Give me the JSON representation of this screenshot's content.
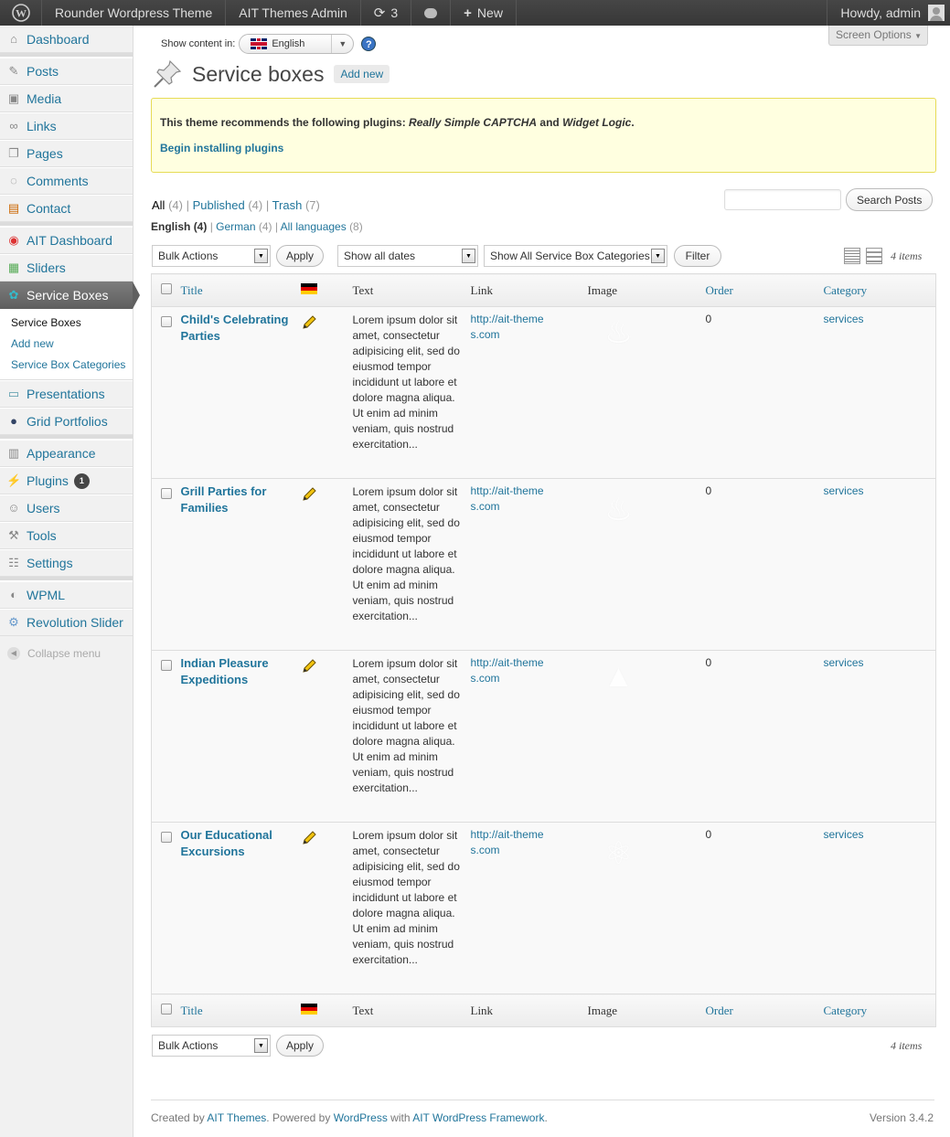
{
  "adminbar": {
    "site_name": "Rounder Wordpress Theme",
    "ait_admin": "AIT Themes Admin",
    "updates_count": "3",
    "new_label": "New",
    "howdy": "Howdy, admin"
  },
  "sidebar": {
    "dashboard": "Dashboard",
    "posts": "Posts",
    "media": "Media",
    "links": "Links",
    "pages": "Pages",
    "comments": "Comments",
    "contact": "Contact",
    "ait_dashboard": "AIT Dashboard",
    "sliders": "Sliders",
    "service_boxes": "Service Boxes",
    "sub_service_boxes": "Service Boxes",
    "sub_add_new": "Add new",
    "sub_categories": "Service Box Categories",
    "presentations": "Presentations",
    "grid_portfolios": "Grid Portfolios",
    "appearance": "Appearance",
    "plugins": "Plugins",
    "plugins_badge": "1",
    "users": "Users",
    "tools": "Tools",
    "settings": "Settings",
    "wpml": "WPML",
    "revolution_slider": "Revolution Slider",
    "collapse": "Collapse menu"
  },
  "header": {
    "show_content_in": "Show content in:",
    "language": "English",
    "screen_options": "Screen Options",
    "title": "Service boxes",
    "add_new": "Add new"
  },
  "notice": {
    "text_before": "This theme recommends the following plugins:",
    "plugin1": "Really Simple CAPTCHA",
    "and": "and",
    "plugin2": "Widget Logic",
    "period": ".",
    "begin": "Begin installing plugins"
  },
  "filters": {
    "all": "All",
    "all_count": "(4)",
    "published": "Published",
    "published_count": "(4)",
    "trash": "Trash",
    "trash_count": "(7)",
    "english": "English",
    "english_count": "(4)",
    "german": "German",
    "german_count": "(4)",
    "all_languages": "All languages",
    "all_languages_count": "(8)",
    "search_button": "Search Posts"
  },
  "tablenav": {
    "bulk_actions": "Bulk Actions",
    "apply": "Apply",
    "dates": "Show all dates",
    "categories": "Show All Service Box Categories",
    "filter": "Filter",
    "items": "4 items"
  },
  "columns": {
    "title": "Title",
    "text": "Text",
    "link": "Link",
    "image": "Image",
    "order": "Order",
    "category": "Category"
  },
  "rows": [
    {
      "title": "Child's Celebrating Parties",
      "text": "Lorem ipsum dolor sit amet, consectetur adipisicing elit, sed do eiusmod tempor incididunt ut labore et dolore magna aliqua. Ut enim ad minim veniam, quis nostrud exercitation...",
      "link": "http://ait-themes.com",
      "order": "0",
      "category": "services",
      "image_icon": "cake-icon"
    },
    {
      "title": "Grill Parties for Families",
      "text": "Lorem ipsum dolor sit amet, consectetur adipisicing elit, sed do eiusmod tempor incididunt ut labore et dolore magna aliqua. Ut enim ad minim veniam, quis nostrud exercitation...",
      "link": "http://ait-themes.com",
      "order": "0",
      "category": "services",
      "image_icon": "fire-icon"
    },
    {
      "title": "Indian Pleasure Expeditions",
      "text": "Lorem ipsum dolor sit amet, consectetur adipisicing elit, sed do eiusmod tempor incididunt ut labore et dolore magna aliqua. Ut enim ad minim veniam, quis nostrud exercitation...",
      "link": "http://ait-themes.com",
      "order": "0",
      "category": "services",
      "image_icon": "tent-icon"
    },
    {
      "title": "Our Educational Excursions",
      "text": "Lorem ipsum dolor sit amet, consectetur adipisicing elit, sed do eiusmod tempor incididunt ut labore et dolore magna aliqua. Ut enim ad minim veniam, quis nostrud exercitation...",
      "link": "http://ait-themes.com",
      "order": "0",
      "category": "services",
      "image_icon": "atom-icon"
    }
  ],
  "footer": {
    "created_by": "Created by",
    "ait_themes": "AIT Themes",
    "powered_by": ". Powered by",
    "wordpress": "WordPress",
    "with": "with",
    "framework": "AIT WordPress Framework",
    "period": ".",
    "version": "Version 3.4.2"
  },
  "colors": {
    "link": "#21759b",
    "notice_bg": "#ffffe0",
    "notice_border": "#e6db55",
    "adminbar": "#464646",
    "current_menu": "#6d6d6d"
  }
}
